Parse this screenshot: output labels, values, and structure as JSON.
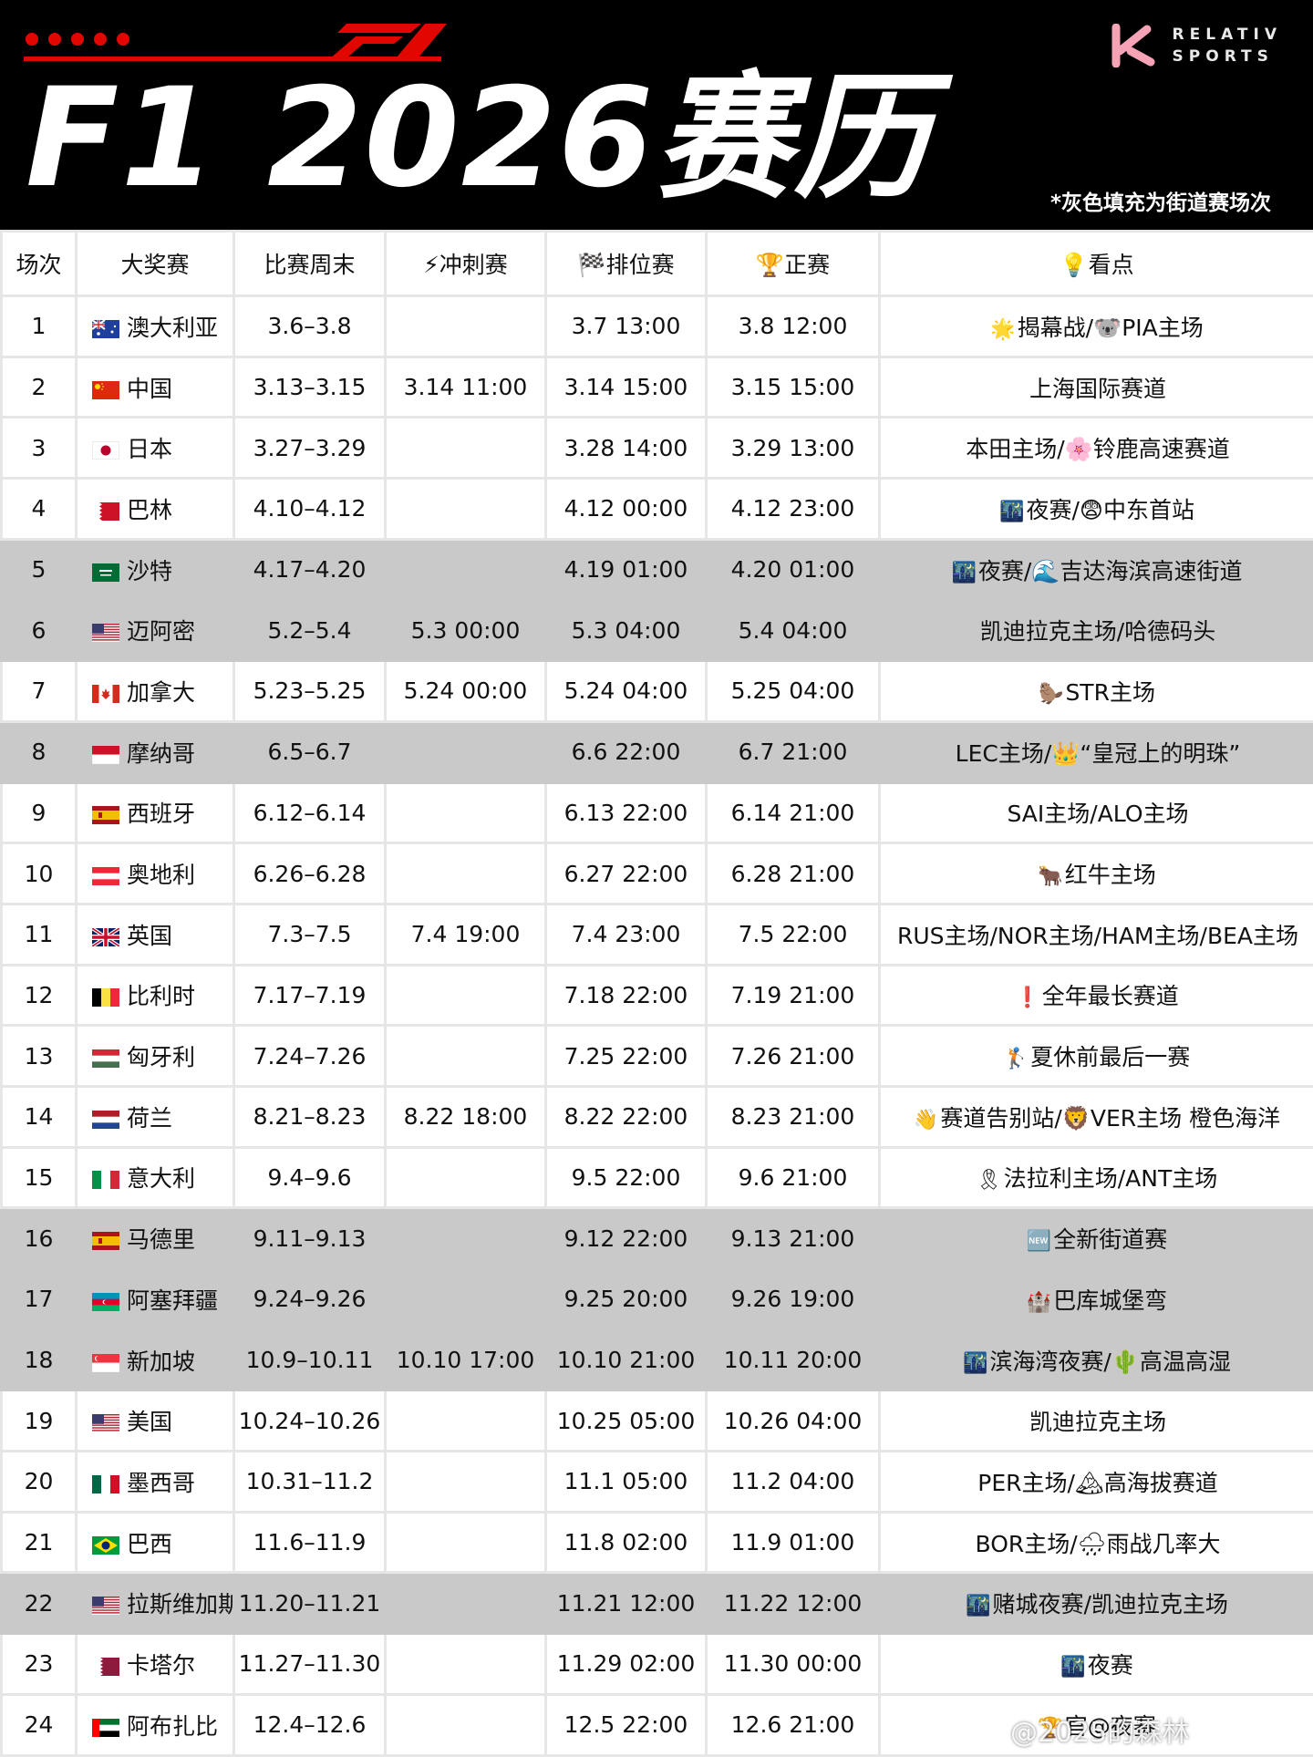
{
  "header": {
    "title": "F1  2026赛历",
    "brand_line1": "RELATIV",
    "brand_line2": "SPORTS",
    "note": "*灰色填充为街道赛场次"
  },
  "columns": [
    "场次",
    "大奖赛",
    "比赛周末",
    "冲刺赛",
    "排位赛",
    "正赛",
    "看点"
  ],
  "column_icons": {
    "sprint": "⚡",
    "qualifying": "🏁",
    "race": "🏆",
    "highlight": "💡"
  },
  "colors": {
    "accent_red": "#e10600",
    "street_fill": "#c9c9c9"
  },
  "rows": [
    {
      "no": "1",
      "gp": "澳大利亚",
      "weekend": "3.6–3.8",
      "sprint": "",
      "quali": "3.7 13:00",
      "race": "3.8 12:00",
      "highlight": "揭幕战/🐨PIA主场",
      "icon": "🌟",
      "street": false,
      "flag": "australia"
    },
    {
      "no": "2",
      "gp": "中国",
      "weekend": "3.13–3.15",
      "sprint": "3.14 11:00",
      "quali": "3.14 15:00",
      "race": "3.15 15:00",
      "highlight": "上海国际赛道",
      "icon": "",
      "street": false,
      "flag": "china"
    },
    {
      "no": "3",
      "gp": "日本",
      "weekend": "3.27–3.29",
      "sprint": "",
      "quali": "3.28 14:00",
      "race": "3.29 13:00",
      "highlight": "本田主场/🌸铃鹿高速赛道",
      "icon": "",
      "street": false,
      "flag": "japan"
    },
    {
      "no": "4",
      "gp": "巴林",
      "weekend": "4.10–4.12",
      "sprint": "",
      "quali": "4.12 00:00",
      "race": "4.12 23:00",
      "highlight": "夜赛/😨中东首站",
      "icon": "🌃",
      "street": false,
      "flag": "bahrain"
    },
    {
      "no": "5",
      "gp": "沙特",
      "weekend": "4.17–4.20",
      "sprint": "",
      "quali": "4.19 01:00",
      "race": "4.20 01:00",
      "highlight": "夜赛/🌊吉达海滨高速街道",
      "icon": "🌃",
      "street": true,
      "flag": "saudi"
    },
    {
      "no": "6",
      "gp": "迈阿密",
      "weekend": "5.2–5.4",
      "sprint": "5.3 00:00",
      "quali": "5.3 04:00",
      "race": "5.4 04:00",
      "highlight": "凯迪拉克主场/哈德码头",
      "icon": "",
      "street": true,
      "flag": "usa"
    },
    {
      "no": "7",
      "gp": "加拿大",
      "weekend": "5.23–5.25",
      "sprint": "5.24 00:00",
      "quali": "5.24 04:00",
      "race": "5.25 04:00",
      "highlight": "STR主场",
      "icon": "🦫",
      "street": false,
      "flag": "canada"
    },
    {
      "no": "8",
      "gp": "摩纳哥",
      "weekend": "6.5–6.7",
      "sprint": "",
      "quali": "6.6 22:00",
      "race": "6.7 21:00",
      "highlight": "LEC主场/👑“皇冠上的明珠”",
      "icon": "",
      "street": true,
      "flag": "monaco"
    },
    {
      "no": "9",
      "gp": "西班牙",
      "weekend": "6.12–6.14",
      "sprint": "",
      "quali": "6.13 22:00",
      "race": "6.14 21:00",
      "highlight": "SAI主场/ALO主场",
      "icon": "",
      "street": false,
      "flag": "spain"
    },
    {
      "no": "10",
      "gp": "奥地利",
      "weekend": "6.26–6.28",
      "sprint": "",
      "quali": "6.27 22:00",
      "race": "6.28 21:00",
      "highlight": "红牛主场",
      "icon": "🐂",
      "street": false,
      "flag": "austria"
    },
    {
      "no": "11",
      "gp": "英国",
      "weekend": "7.3–7.5",
      "sprint": "7.4 19:00",
      "quali": "7.4 23:00",
      "race": "7.5 22:00",
      "highlight": "RUS主场/NOR主场/HAM主场/BEA主场",
      "icon": "",
      "street": false,
      "flag": "uk"
    },
    {
      "no": "12",
      "gp": "比利时",
      "weekend": "7.17–7.19",
      "sprint": "",
      "quali": "7.18 22:00",
      "race": "7.19 21:00",
      "highlight": "全年最长赛道",
      "icon": "❗",
      "street": false,
      "flag": "belgium"
    },
    {
      "no": "13",
      "gp": "匈牙利",
      "weekend": "7.24–7.26",
      "sprint": "",
      "quali": "7.25 22:00",
      "race": "7.26 21:00",
      "highlight": "夏休前最后一赛",
      "icon": "🏌",
      "street": false,
      "flag": "hungary"
    },
    {
      "no": "14",
      "gp": "荷兰",
      "weekend": "8.21–8.23",
      "sprint": "8.22 18:00",
      "quali": "8.22 22:00",
      "race": "8.23 21:00",
      "highlight": "赛道告别站/🦁VER主场 橙色海洋",
      "icon": "👋",
      "street": false,
      "flag": "netherlands"
    },
    {
      "no": "15",
      "gp": "意大利",
      "weekend": "9.4–9.6",
      "sprint": "",
      "quali": "9.5 22:00",
      "race": "9.6 21:00",
      "highlight": "法拉利主场/ANT主场",
      "icon": "🎗",
      "street": false,
      "flag": "italy"
    },
    {
      "no": "16",
      "gp": "马德里",
      "weekend": "9.11–9.13",
      "sprint": "",
      "quali": "9.12 22:00",
      "race": "9.13 21:00",
      "highlight": "全新街道赛",
      "icon": "🆕",
      "street": true,
      "flag": "spain"
    },
    {
      "no": "17",
      "gp": "阿塞拜疆",
      "weekend": "9.24–9.26",
      "sprint": "",
      "quali": "9.25 20:00",
      "race": "9.26 19:00",
      "highlight": "巴库城堡弯",
      "icon": "🏰",
      "street": true,
      "flag": "azerbaijan"
    },
    {
      "no": "18",
      "gp": "新加坡",
      "weekend": "10.9–10.11",
      "sprint": "10.10 17:00",
      "quali": "10.10 21:00",
      "race": "10.11 20:00",
      "highlight": "滨海湾夜赛/🌵高温高湿",
      "icon": "🌃",
      "street": true,
      "flag": "singapore"
    },
    {
      "no": "19",
      "gp": "美国",
      "weekend": "10.24–10.26",
      "sprint": "",
      "quali": "10.25 05:00",
      "race": "10.26 04:00",
      "highlight": "凯迪拉克主场",
      "icon": "",
      "street": false,
      "flag": "usa"
    },
    {
      "no": "20",
      "gp": "墨西哥",
      "weekend": "10.31–11.2",
      "sprint": "",
      "quali": "11.1 05:00",
      "race": "11.2 04:00",
      "highlight": "PER主场/🏔高海拔赛道",
      "icon": "",
      "street": false,
      "flag": "mexico"
    },
    {
      "no": "21",
      "gp": "巴西",
      "weekend": "11.6–11.9",
      "sprint": "",
      "quali": "11.8 02:00",
      "race": "11.9 01:00",
      "highlight": "BOR主场/🌧雨战几率大",
      "icon": "",
      "street": false,
      "flag": "brazil"
    },
    {
      "no": "22",
      "gp": "拉斯维加斯",
      "weekend": "11.20–11.21",
      "sprint": "",
      "quali": "11.21 12:00",
      "race": "11.22 12:00",
      "highlight": "赌城夜赛/凯迪拉克主场",
      "icon": "🌃",
      "street": true,
      "flag": "usa"
    },
    {
      "no": "23",
      "gp": "卡塔尔",
      "weekend": "11.27–11.30",
      "sprint": "",
      "quali": "11.29 02:00",
      "race": "11.30 00:00",
      "highlight": "夜赛",
      "icon": "🌃",
      "street": false,
      "flag": "qatar"
    },
    {
      "no": "24",
      "gp": "阿布扎比",
      "weekend": "12.4–12.6",
      "sprint": "",
      "quali": "12.5 22:00",
      "race": "12.6 21:00",
      "highlight": "官@夜赛",
      "icon": "🏆",
      "street": false,
      "flag": "uae"
    }
  ],
  "watermark": "@2025的森林"
}
